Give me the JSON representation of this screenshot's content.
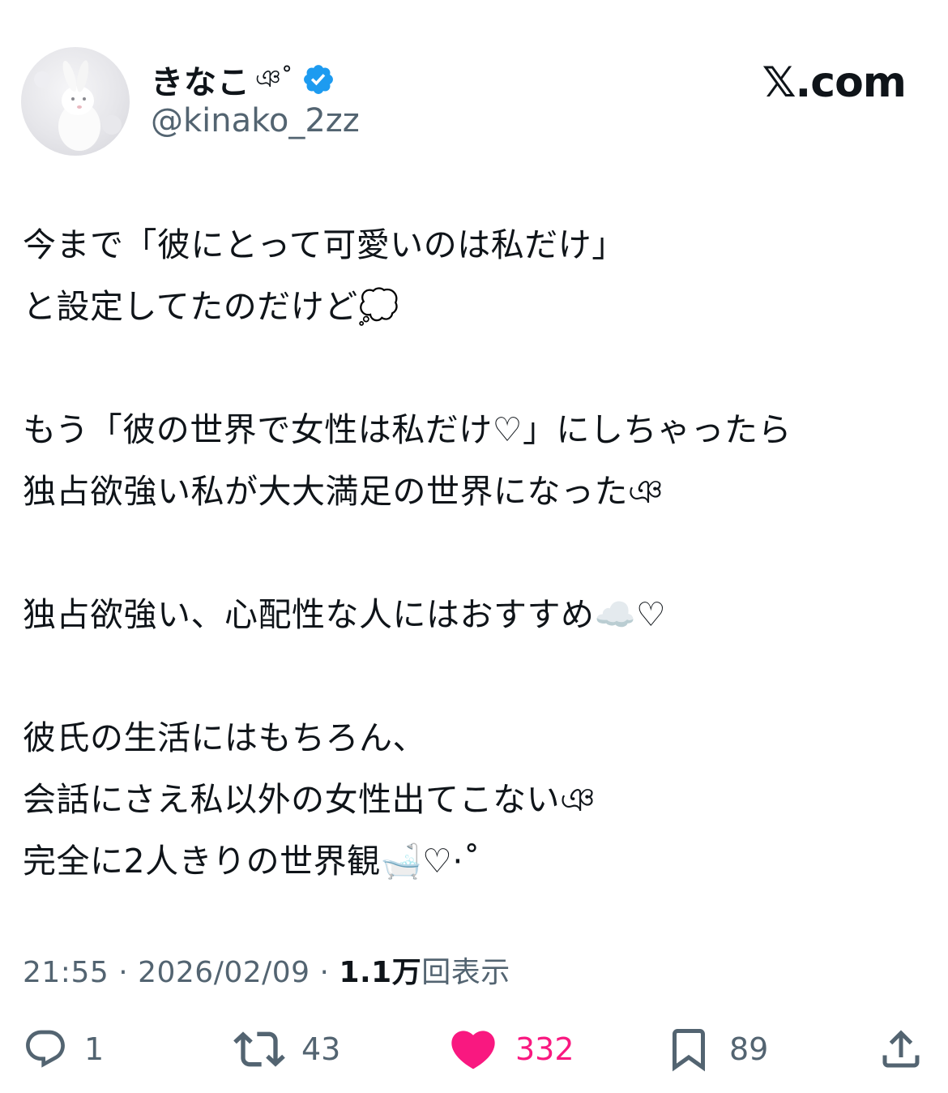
{
  "user": {
    "display_name": "きなこ",
    "name_deco": "ঞ˚",
    "handle": "@kinako_2zz",
    "verified": true
  },
  "brand": "𝕏.com",
  "tweet": {
    "lines": [
      "今まで「彼にとって可愛いのは私だけ」",
      "と設定してたのだけど💭",
      "",
      "もう「彼の世界で女性は私だけ♡」にしちゃったら",
      "独占欲強い私が大大満足の世界になったঞ",
      "",
      "独占欲強い、心配性な人にはおすすめ☁️♡",
      "",
      "彼氏の生活にはもちろん、",
      "会話にさえ私以外の女性出てこないঞ",
      "完全に2人きりの世界観🛁♡·˚"
    ]
  },
  "meta": {
    "time": "21:55",
    "sep1": " · ",
    "date": "2026/02/09",
    "sep2": " · ",
    "views_count": "1.1万",
    "views_label": "回表示"
  },
  "actions": {
    "replies": "1",
    "reposts": "43",
    "likes": "332",
    "bookmarks": "89"
  },
  "colors": {
    "text": "#0f1419",
    "secondary": "#536471",
    "verified": "#1d9bf0",
    "like": "#f91880"
  },
  "icons": [
    "verified-badge-icon",
    "reply-icon",
    "repost-icon",
    "heart-icon",
    "bookmark-icon",
    "share-icon"
  ]
}
